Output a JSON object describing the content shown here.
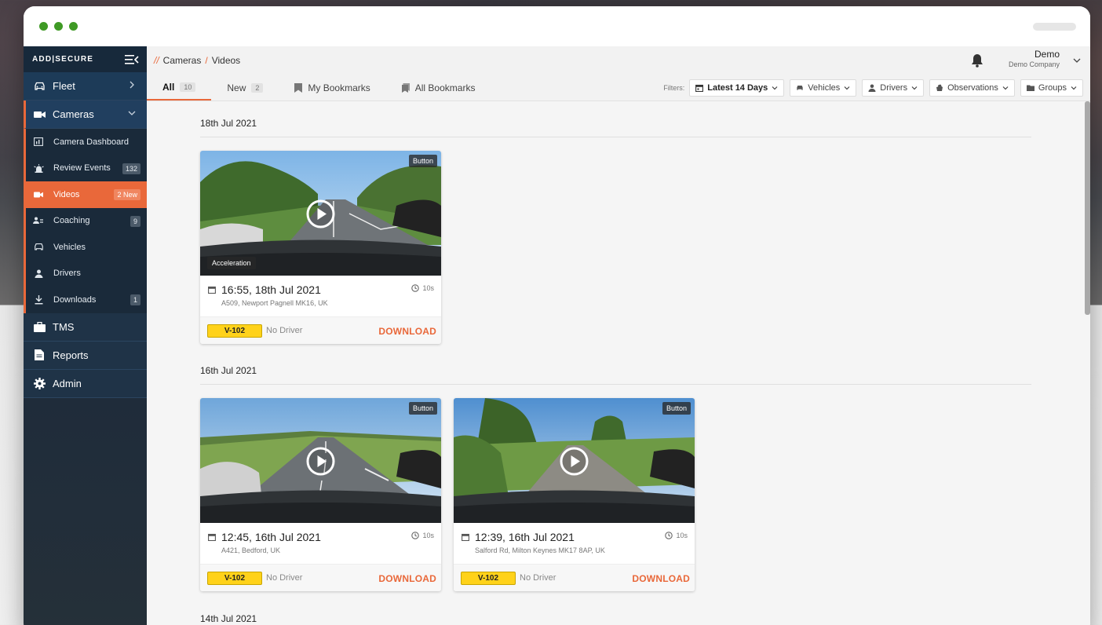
{
  "app": {
    "logo": "ADD|SECURE"
  },
  "sidebar": {
    "fleet": "Fleet",
    "cameras": "Cameras",
    "sub_items": [
      {
        "label": "Camera Dashboard",
        "badge": ""
      },
      {
        "label": "Review Events",
        "badge": "132"
      },
      {
        "label": "Videos",
        "badge": "2 New"
      },
      {
        "label": "Coaching",
        "badge": "9"
      },
      {
        "label": "Vehicles",
        "badge": ""
      },
      {
        "label": "Drivers",
        "badge": ""
      },
      {
        "label": "Downloads",
        "badge": "1"
      }
    ],
    "tms": "TMS",
    "reports": "Reports",
    "admin": "Admin"
  },
  "breadcrumb": {
    "prefix": "//",
    "parent": "Cameras",
    "separator": "/",
    "current": "Videos"
  },
  "user": {
    "name": "Demo",
    "company": "Demo Company"
  },
  "tabs": [
    {
      "label": "All",
      "count": "10"
    },
    {
      "label": "New",
      "count": "2"
    },
    {
      "label": "My Bookmarks"
    },
    {
      "label": "All Bookmarks"
    }
  ],
  "filters": {
    "label": "Filters:",
    "date": "Latest 14 Days",
    "vehicles": "Vehicles",
    "drivers": "Drivers",
    "observations": "Observations",
    "groups": "Groups"
  },
  "sections": [
    {
      "title": "18th Jul 2021",
      "videos": [
        {
          "tag": "Button",
          "event": "Acceleration",
          "time": "16:55, 18th Jul 2021",
          "address": "A509, Newport Pagnell MK16, UK",
          "duration": "10s",
          "vehicle": "V-102",
          "driver": "No Driver",
          "action": "DOWNLOAD"
        }
      ]
    },
    {
      "title": "16th Jul 2021",
      "videos": [
        {
          "tag": "Button",
          "time": "12:45, 16th Jul 2021",
          "address": "A421, Bedford, UK",
          "duration": "10s",
          "vehicle": "V-102",
          "driver": "No Driver",
          "action": "DOWNLOAD"
        },
        {
          "tag": "Button",
          "time": "12:39, 16th Jul 2021",
          "address": "Salford Rd, Milton Keynes MK17 8AP, UK",
          "duration": "10s",
          "vehicle": "V-102",
          "driver": "No Driver",
          "action": "DOWNLOAD"
        }
      ]
    },
    {
      "title": "14th Jul 2021"
    }
  ],
  "colors": {
    "accent": "#e9683a",
    "sidebar": "#1d3b58",
    "plate": "#ffd21a",
    "window_dots": "#3f9a25"
  },
  "icons": {
    "fleet": "car-icon",
    "cameras": "video-camera-icon",
    "tms": "briefcase-icon",
    "reports": "document-icon",
    "admin": "gear-icon",
    "notifications": "bell-icon"
  }
}
